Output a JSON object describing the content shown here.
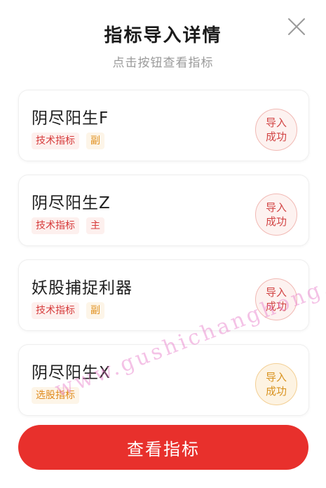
{
  "modal": {
    "title": "指标导入详情",
    "subtitle": "点击按钮查看指标",
    "close_icon": "close-icon"
  },
  "items": [
    {
      "name": "阴尽阳生F",
      "tags": [
        "技术指标",
        "副"
      ],
      "status_line1": "导入",
      "status_line2": "成功"
    },
    {
      "name": "阴尽阳生Z",
      "tags": [
        "技术指标",
        "主"
      ],
      "status_line1": "导入",
      "status_line2": "成功"
    },
    {
      "name": "妖股捕捉利器",
      "tags": [
        "技术指标",
        "副"
      ],
      "status_line1": "导入",
      "status_line2": "成功"
    },
    {
      "name": "阴尽阳生X",
      "tags": [
        "选股指标"
      ],
      "status_line1": "导入",
      "status_line2": "成功"
    }
  ],
  "primary_button": {
    "label": "查看指标"
  },
  "watermark": "www.gushichanghong.com",
  "colors": {
    "accent": "#e8302c",
    "tag_red": "#d63a3a",
    "tag_orange": "#e08a1c"
  }
}
